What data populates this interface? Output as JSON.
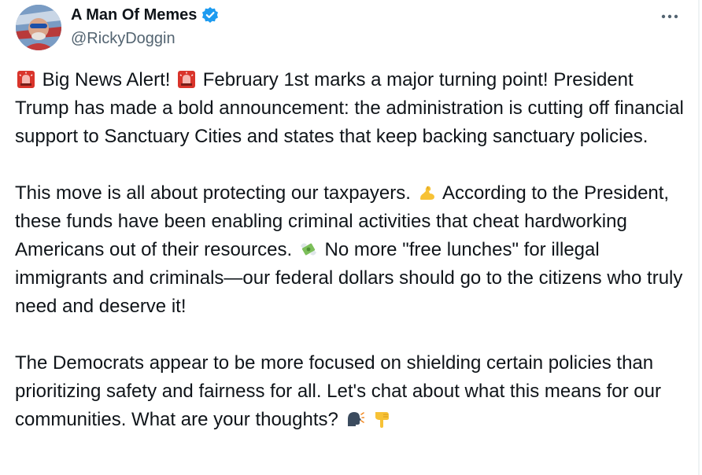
{
  "author": {
    "display_name": "A Man Of Memes",
    "handle": "@RickyDoggin",
    "verified": true,
    "avatar_icon": "avatar-photo",
    "verified_icon": "verified-badge-icon"
  },
  "actions": {
    "more_icon": "more-options-icon"
  },
  "tweet": {
    "p1": {
      "s1": "Big News Alert!",
      "s2": "February 1st marks a major turning point! President Trump has made a bold announcement: the administration is cutting off financial support to Sanctuary Cities and states that keep backing sanctuary policies.",
      "icons": [
        "siren-emoji",
        "siren-emoji"
      ]
    },
    "p2": {
      "s1": "This move is all about protecting our taxpayers.",
      "s2": "According to the President, these funds have been enabling criminal activities that cheat hardworking Americans out of their resources.",
      "s3": "No more \"free lunches\" for illegal immigrants and criminals—our federal dollars should go to the citizens who truly need and deserve it!",
      "icons": [
        "flexed-biceps-emoji",
        "money-with-wings-emoji"
      ]
    },
    "p3": {
      "s1": "The Democrats appear to be more focused on shielding certain policies than prioritizing safety and fairness for all. Let's chat about what this means for our communities. What are your thoughts?",
      "icons": [
        "speaking-head-emoji",
        "pointing-down-emoji"
      ]
    }
  },
  "colors": {
    "text": "#0f1419",
    "secondary_text": "#536471",
    "verified_blue": "#1d9bf0",
    "background": "#ffffff"
  }
}
